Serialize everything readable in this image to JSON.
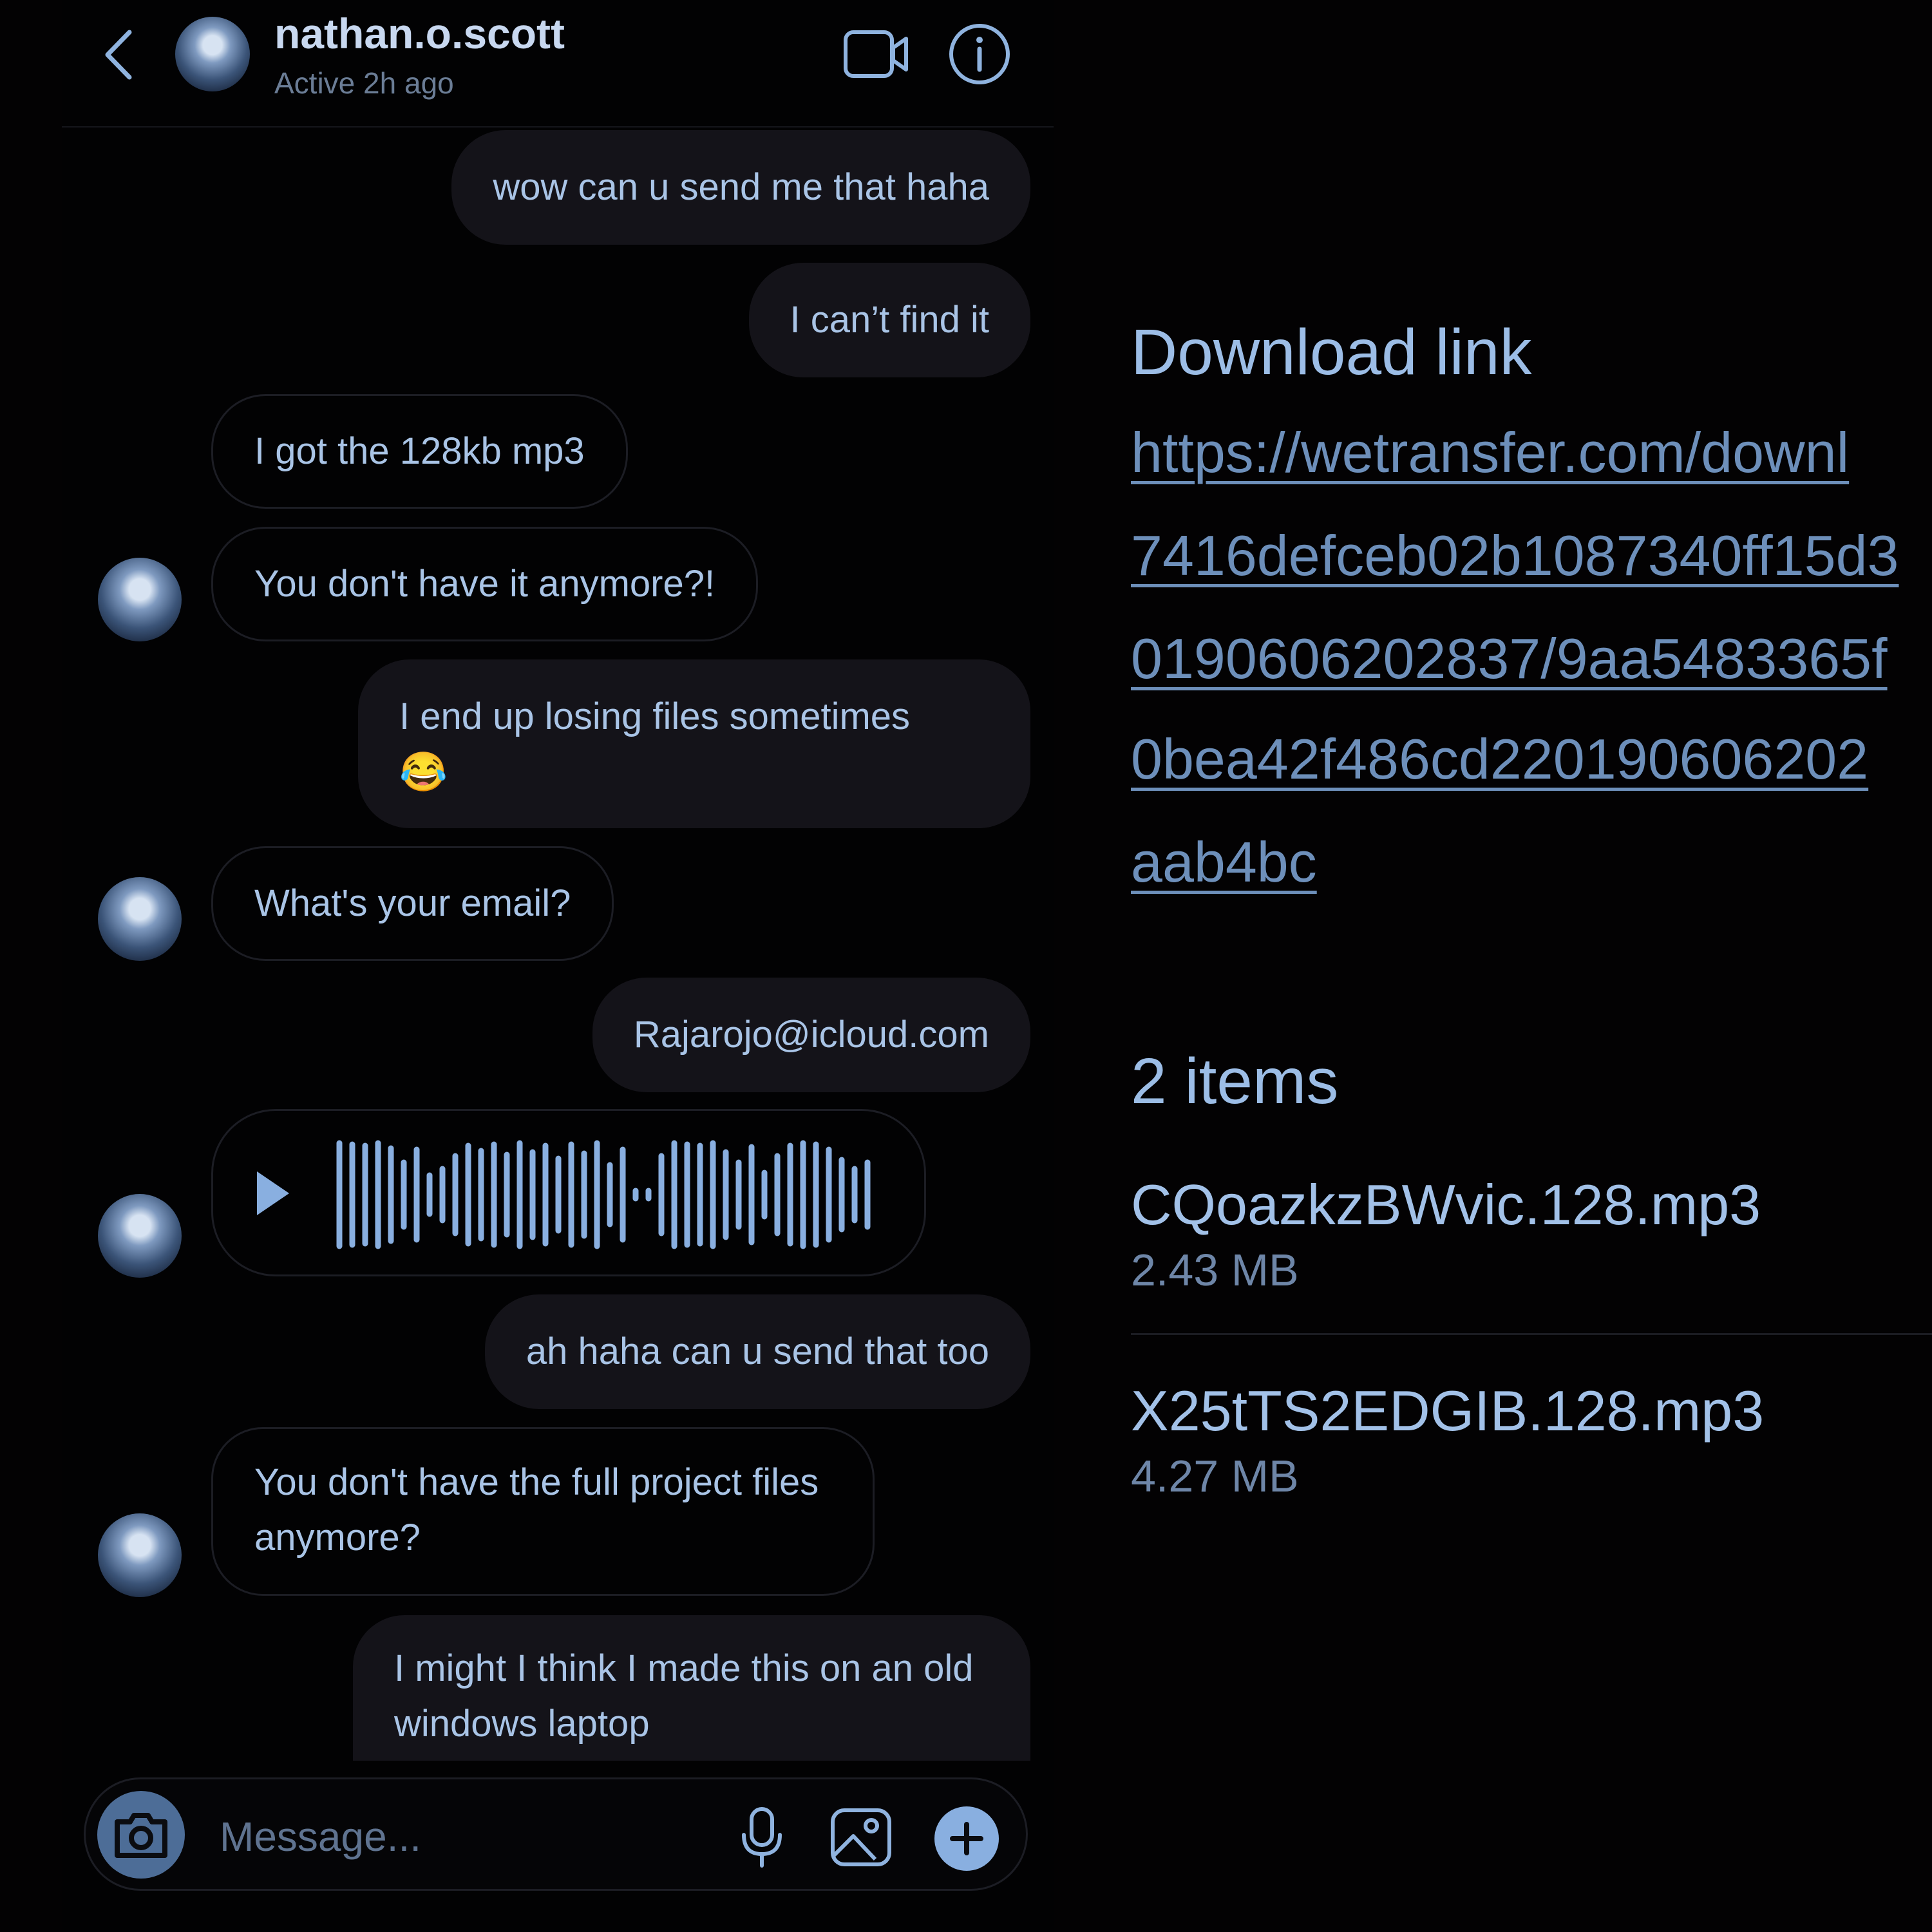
{
  "chat": {
    "contact_name": "nathan.o.scott",
    "contact_status": "Active 2h ago",
    "messages": [
      {
        "text": "wow can u send me that haha"
      },
      {
        "text": "I can’t find it"
      },
      {
        "text": "I got the 128kb mp3"
      },
      {
        "text": "You don't have it anymore?!"
      },
      {
        "text": "I end up losing files sometimes",
        "emoji": "😂"
      },
      {
        "text": "What's your email?"
      },
      {
        "text": "Rajarojo@icloud.com"
      },
      {
        "text": "ah haha can u send that too"
      },
      {
        "text": "You don't have the full project files anymore?"
      },
      {
        "text": "I might I think I made this on an old windows laptop"
      }
    ],
    "composer_placeholder": "Message..."
  },
  "transfer": {
    "download_heading": "Download link",
    "link_lines": [
      "https://wetransfer.com/downl",
      "7416defceb02b1087340ff15d3",
      "0190606202837/9aa5483365f",
      "0bea42f486cd220190606202",
      "aab4bc"
    ],
    "items_heading": "2 items",
    "files": [
      {
        "name": "CQoazkzBWvic.128.mp3",
        "size": "2.43 MB"
      },
      {
        "name": "X25tTS2EDGIB.128.mp3",
        "size": "4.27 MB"
      }
    ]
  },
  "colors": {
    "accent": "#89afe0",
    "background": "#030203",
    "bubble_out": "#141319"
  },
  "icons": [
    "chevron-left-icon",
    "video-camera-icon",
    "info-icon",
    "play-icon",
    "camera-icon",
    "microphone-icon",
    "gallery-icon",
    "plus-icon"
  ]
}
